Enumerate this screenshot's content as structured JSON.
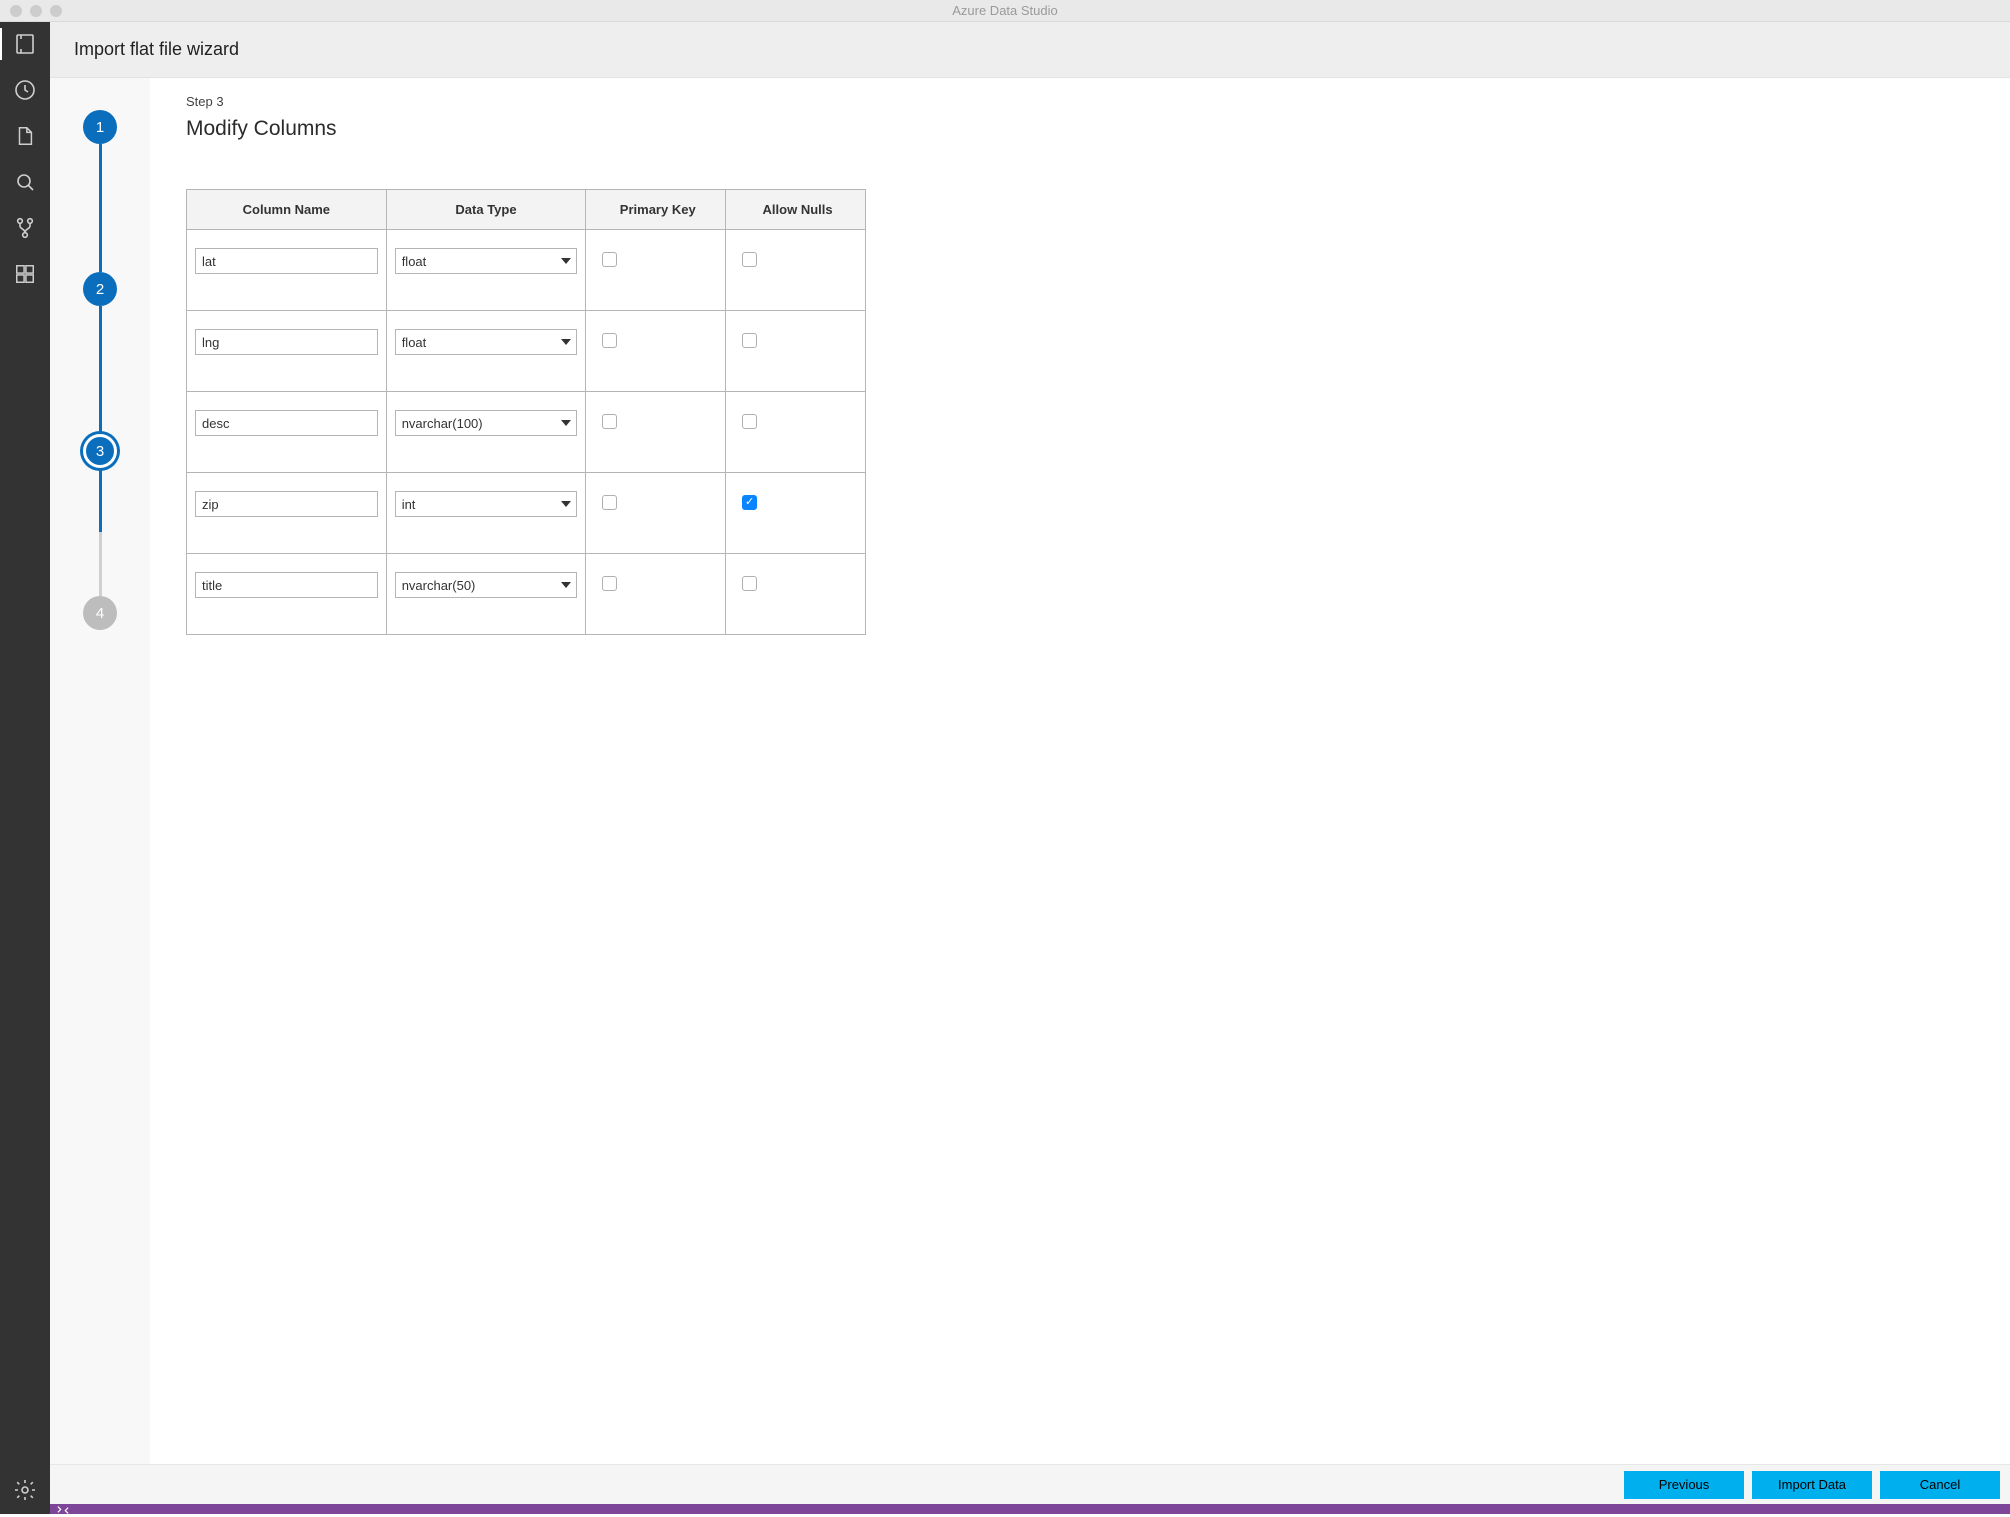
{
  "window": {
    "title": "Azure Data Studio"
  },
  "wizard": {
    "title": "Import flat file wizard",
    "step_label": "Step 3",
    "page_title": "Modify Columns",
    "steps": {
      "s1": "1",
      "s2": "2",
      "s3": "3",
      "s4": "4"
    }
  },
  "table": {
    "headers": {
      "name": "Column Name",
      "type": "Data Type",
      "pk": "Primary Key",
      "nulls": "Allow Nulls"
    },
    "rows": [
      {
        "name": "lat",
        "type": "float",
        "pk": false,
        "nulls": false
      },
      {
        "name": "lng",
        "type": "float",
        "pk": false,
        "nulls": false
      },
      {
        "name": "desc",
        "type": "nvarchar(100)",
        "pk": false,
        "nulls": false
      },
      {
        "name": "zip",
        "type": "int",
        "pk": false,
        "nulls": true
      },
      {
        "name": "title",
        "type": "nvarchar(50)",
        "pk": false,
        "nulls": false
      }
    ]
  },
  "footer": {
    "previous": "Previous",
    "import": "Import Data",
    "cancel": "Cancel"
  }
}
